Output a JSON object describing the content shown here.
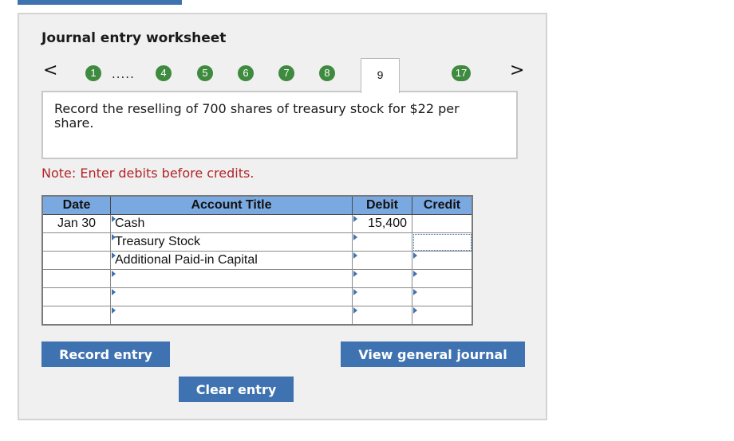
{
  "worksheet": {
    "title": "Journal entry worksheet",
    "nav_prev": "<",
    "nav_next": ">",
    "steps": [
      "1",
      "4",
      "5",
      "6",
      "7",
      "8"
    ],
    "ellipsis": ".....",
    "active_step": "9",
    "last_step": "17",
    "step_color": "#3e8a3e"
  },
  "instruction": "Record the reselling of 700 shares of treasury stock for $22 per share.",
  "note": "Note: Enter debits before credits.",
  "table": {
    "headers": {
      "date": "Date",
      "account": "Account Title",
      "debit": "Debit",
      "credit": "Credit"
    },
    "rows": [
      {
        "date": "Jan 30",
        "account": "Cash",
        "debit": "15,400",
        "credit": ""
      },
      {
        "date": "",
        "account": "Treasury Stock",
        "debit": "",
        "credit": ""
      },
      {
        "date": "",
        "account": "Additional Paid-in Capital",
        "debit": "",
        "credit": ""
      },
      {
        "date": "",
        "account": "",
        "debit": "",
        "credit": ""
      },
      {
        "date": "",
        "account": "",
        "debit": "",
        "credit": ""
      },
      {
        "date": "",
        "account": "",
        "debit": "",
        "credit": ""
      }
    ]
  },
  "buttons": {
    "record": "Record entry",
    "view": "View general journal",
    "clear": "Clear entry"
  },
  "colors": {
    "accent": "#3f72b0",
    "header": "#7aa8e0",
    "note": "#b3242a"
  }
}
